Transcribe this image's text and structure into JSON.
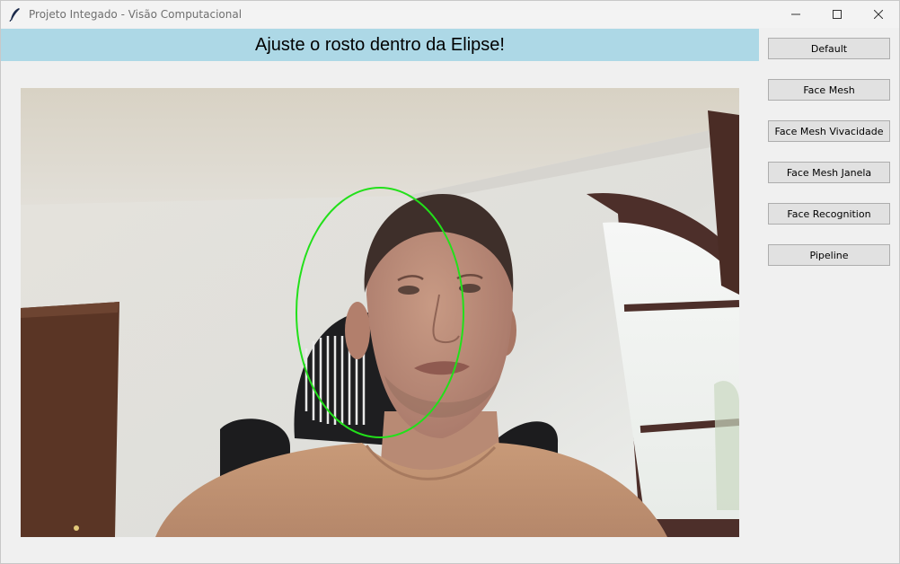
{
  "window": {
    "title": "Projeto Integado - Visão Computacional",
    "icon": "feather-icon"
  },
  "banner": {
    "text": "Ajuste o rosto dentro da Elipse!",
    "background": "#add8e6"
  },
  "video": {
    "overlay_color": "#22e01a",
    "overlay_shape": "ellipse"
  },
  "buttons": [
    {
      "label": "Default"
    },
    {
      "label": "Face Mesh"
    },
    {
      "label": "Face Mesh Vivacidade"
    },
    {
      "label": "Face Mesh Janela"
    },
    {
      "label": "Face Recognition"
    },
    {
      "label": "Pipeline"
    }
  ]
}
